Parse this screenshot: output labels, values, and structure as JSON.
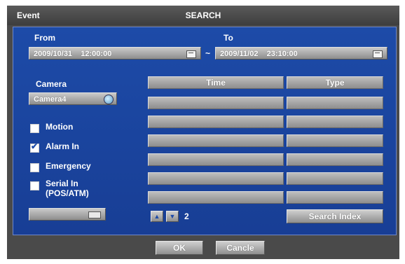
{
  "window": {
    "title_left": "Event",
    "title_center": "SEARCH"
  },
  "from": {
    "label": "From",
    "value": "2009/10/31    12:00:00"
  },
  "to": {
    "label": "To",
    "value": "2009/11/02    23:10:00"
  },
  "range_separator": "~",
  "camera": {
    "label": "Camera",
    "value": "Camera4"
  },
  "filters": [
    {
      "label": "Motion",
      "checked": false
    },
    {
      "label": "Alarm In",
      "checked": true
    },
    {
      "label": "Emergency",
      "checked": false
    },
    {
      "label": "Serial In (POS/ATM)",
      "line1": "Serial In",
      "line2": "(POS/ATM)",
      "checked": false
    }
  ],
  "table": {
    "columns": [
      "Time",
      "Type"
    ],
    "rows": [
      [
        "",
        ""
      ],
      [
        "",
        ""
      ],
      [
        "",
        ""
      ],
      [
        "",
        ""
      ],
      [
        "",
        ""
      ],
      [
        "",
        ""
      ]
    ]
  },
  "pagination": {
    "page": "2"
  },
  "buttons": {
    "search_index": "Search Index",
    "ok": "OK",
    "cancel": "Cancle"
  }
}
